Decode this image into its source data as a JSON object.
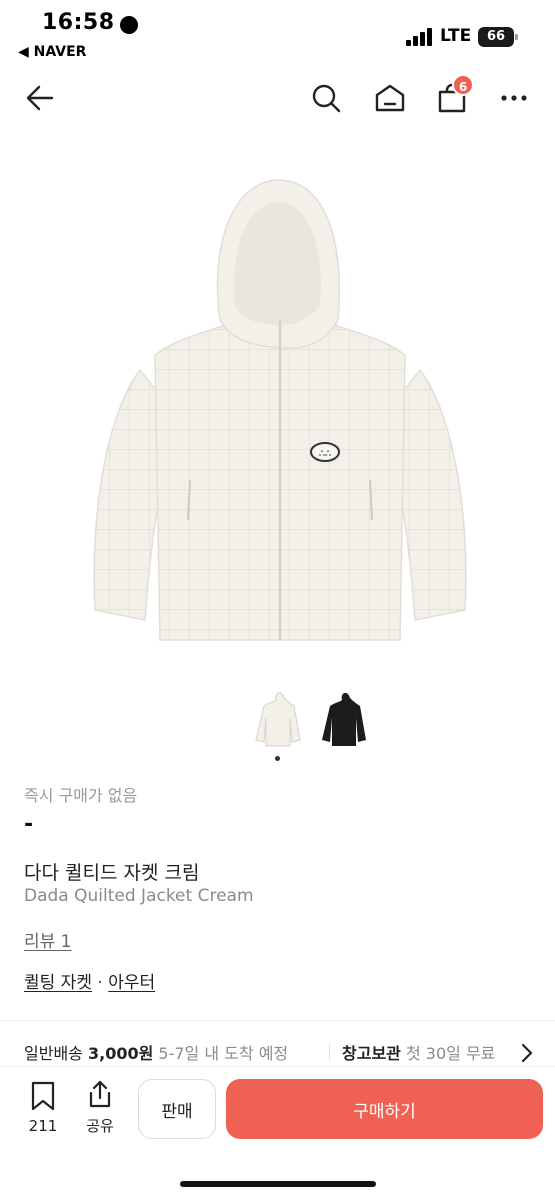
{
  "status_bar": {
    "time": "16:58",
    "back_app": "◀ NAVER",
    "network": "LTE",
    "battery": "66"
  },
  "nav": {
    "cart_count": "6"
  },
  "product": {
    "instant_buy_status": "즉시 구매가 없음",
    "price": "-",
    "name_ko": "다다 퀼티드 자켓 크림",
    "name_en": "Dada Quilted Jacket Cream",
    "review_link": "리뷰 1",
    "category_1": "퀼팅 자켓",
    "category_separator": "·",
    "category_2": "아우터"
  },
  "shipping": {
    "type": "일반배송",
    "fee": "3,000원",
    "eta": "5-7일 내 도착 예정",
    "storage_title": "창고보관",
    "storage_desc": "첫 30일 무료"
  },
  "bottom_bar": {
    "bookmark_count": "211",
    "share_label": "공유",
    "sell_label": "판매",
    "buy_label": "구매하기"
  },
  "colors": {
    "accent": "#ef6253",
    "jacket_cream": "#f3f0ea",
    "jacket_black": "#1c1c1c"
  }
}
